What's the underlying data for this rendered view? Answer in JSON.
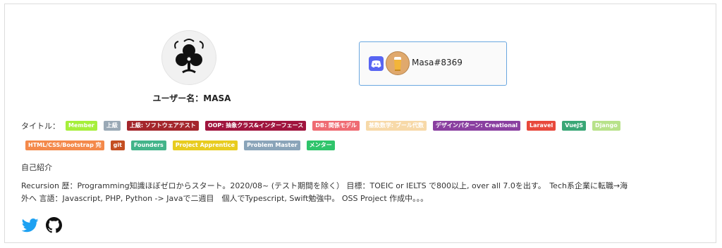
{
  "profile": {
    "username_label": "ユーザー名：MASA"
  },
  "discord": {
    "tag": "Masa#8369"
  },
  "titles": {
    "label": "タイトル：",
    "badges": [
      {
        "text": "Member",
        "color": "#a6ef3b"
      },
      {
        "text": "上級",
        "color": "#9aa9b6"
      },
      {
        "text": "上級: ソフトウェアテスト",
        "color": "#a4262c"
      },
      {
        "text": "OOP: 抽象クラス&インターフェース",
        "color": "#a0153e"
      },
      {
        "text": "DB: 関係モデル",
        "color": "#ef6b73"
      },
      {
        "text": "基数数学: ブール代数",
        "color": "#f7d9a8"
      },
      {
        "text": "デザインパターン: Creational",
        "color": "#8a3fa0"
      },
      {
        "text": "Laravel",
        "color": "#e8493c"
      },
      {
        "text": "VueJS",
        "color": "#3aa776"
      },
      {
        "text": "Django",
        "color": "#b8e28a"
      },
      {
        "text": "HTML/CSS/Bootstrap 完",
        "color": "#f4894a"
      },
      {
        "text": "git",
        "color": "#c44e21"
      },
      {
        "text": "Founders",
        "color": "#43b48a"
      },
      {
        "text": "Project Apprentice",
        "color": "#e8cc1f"
      },
      {
        "text": "Problem Master",
        "color": "#8aa4b9"
      },
      {
        "text": "メンター",
        "color": "#2fc46b"
      }
    ]
  },
  "intro": {
    "heading": "自己紹介",
    "line1": "Recursion 歴：Programming知識ほぼゼロからスタート。2020/08~ (テスト期間を除く） 目標：TOEIC or IELTS で800以上, over all 7.0を出す。　Tech系企業に転職→海",
    "line2": "外へ 言語：Javascript, PHP, Python -> Javaで二週目　個人でTypescript, Swift勉強中。 OSS Project 作成中。。。"
  },
  "social": {
    "twitter_color": "#1da1f2",
    "github_color": "#111111"
  }
}
